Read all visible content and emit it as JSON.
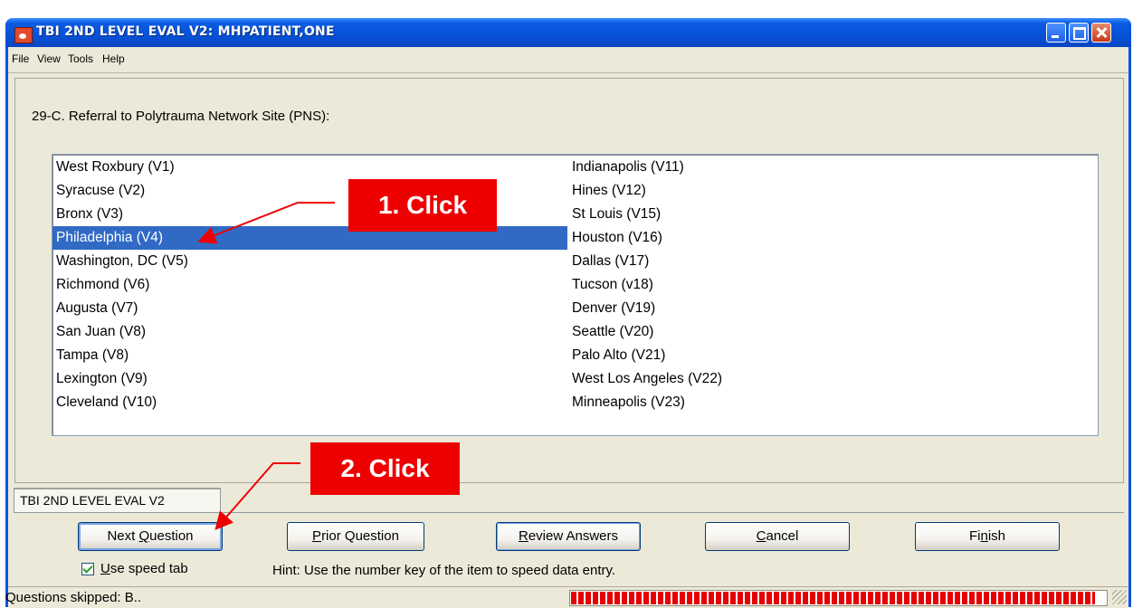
{
  "window": {
    "title": "TBI 2ND LEVEL EVAL V2: MHPATIENT,ONE",
    "colors": {
      "titlebar": "#0651d6",
      "face": "#ece9d8",
      "selection": "#316ac5",
      "callout": "#ee0000"
    }
  },
  "menu": {
    "items": [
      "File",
      "View",
      "Tools",
      "Help"
    ]
  },
  "question": {
    "text": "29-C. Referral to Polytrauma Network Site (PNS):"
  },
  "list": {
    "left_column": [
      "West Roxbury (V1)",
      "Syracuse (V2)",
      "Bronx (V3)",
      "Philadelphia (V4)",
      "Washington, DC (V5)",
      "Richmond (V6)",
      "Augusta (V7)",
      "San Juan (V8)",
      "Tampa (V8)",
      "Lexington (V9)",
      "Cleveland (V10)"
    ],
    "right_column": [
      "Indianapolis (V11)",
      "Hines (V12)",
      "St Louis (V15)",
      "Houston (V16)",
      "Dallas (V17)",
      "Tucson (v18)",
      "Denver (V19)",
      "Seattle (V20)",
      "Palo Alto (V21)",
      "West Los Angeles (V22)",
      "Minneapolis (V23)"
    ],
    "selected": "Philadelphia (V4)"
  },
  "tab": {
    "label": "TBI 2ND LEVEL EVAL V2"
  },
  "buttons": {
    "next": "Next Question",
    "prior": "Prior Question",
    "review": "Review Answers",
    "cancel": "Cancel",
    "finish": "Finish"
  },
  "speed_tab": {
    "label": "Use speed tab",
    "checked": true
  },
  "hint": "Hint: Use the number key of the item to speed data entry.",
  "status": {
    "text": "Questions skipped: B..",
    "progress_fraction": 0.98
  },
  "annotations": {
    "callout_1": "1. Click",
    "callout_2": "2. Click"
  }
}
